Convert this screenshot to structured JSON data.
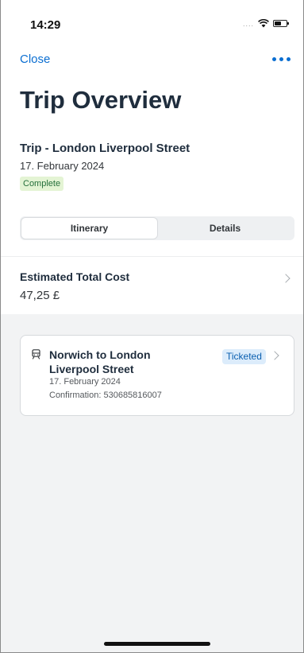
{
  "status_bar": {
    "time": "14:29",
    "signal": "....",
    "icons": [
      "signal-dots-icon",
      "wifi-icon",
      "battery-icon"
    ]
  },
  "nav": {
    "close_label": "Close",
    "more_icon": "more-horizontal-icon"
  },
  "page_title": "Trip Overview",
  "trip": {
    "name": "Trip - London Liverpool Street",
    "date": "17. February 2024",
    "status": "Complete"
  },
  "tabs": [
    {
      "label": "Itinerary",
      "active": true
    },
    {
      "label": "Details",
      "active": false
    }
  ],
  "cost": {
    "label": "Estimated Total Cost",
    "value": "47,25 £"
  },
  "segment": {
    "icon": "train-icon",
    "title": "Norwich to London Liverpool Street",
    "date": "17. February 2024",
    "confirmation": "Confirmation: 530685816007",
    "badge": "Ticketed"
  },
  "colors": {
    "accent": "#0a6ed1",
    "status_complete_bg": "#e4f4d4",
    "badge_bg": "#dcecfb",
    "content_bg": "#f2f3f4"
  }
}
